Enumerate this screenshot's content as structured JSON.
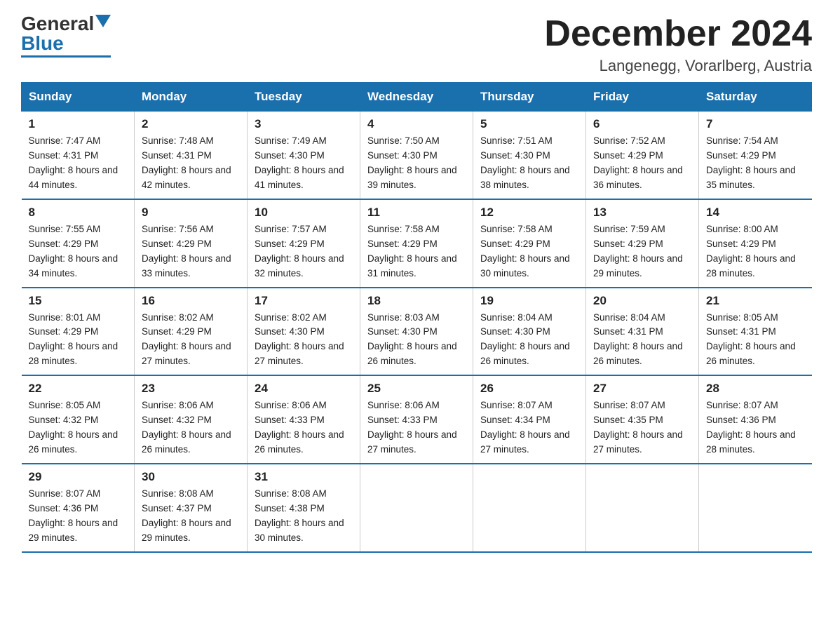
{
  "header": {
    "logo_general": "General",
    "logo_blue": "Blue",
    "month_title": "December 2024",
    "location": "Langenegg, Vorarlberg, Austria"
  },
  "days_of_week": [
    "Sunday",
    "Monday",
    "Tuesday",
    "Wednesday",
    "Thursday",
    "Friday",
    "Saturday"
  ],
  "weeks": [
    [
      {
        "num": "1",
        "sunrise": "7:47 AM",
        "sunset": "4:31 PM",
        "daylight": "8 hours and 44 minutes."
      },
      {
        "num": "2",
        "sunrise": "7:48 AM",
        "sunset": "4:31 PM",
        "daylight": "8 hours and 42 minutes."
      },
      {
        "num": "3",
        "sunrise": "7:49 AM",
        "sunset": "4:30 PM",
        "daylight": "8 hours and 41 minutes."
      },
      {
        "num": "4",
        "sunrise": "7:50 AM",
        "sunset": "4:30 PM",
        "daylight": "8 hours and 39 minutes."
      },
      {
        "num": "5",
        "sunrise": "7:51 AM",
        "sunset": "4:30 PM",
        "daylight": "8 hours and 38 minutes."
      },
      {
        "num": "6",
        "sunrise": "7:52 AM",
        "sunset": "4:29 PM",
        "daylight": "8 hours and 36 minutes."
      },
      {
        "num": "7",
        "sunrise": "7:54 AM",
        "sunset": "4:29 PM",
        "daylight": "8 hours and 35 minutes."
      }
    ],
    [
      {
        "num": "8",
        "sunrise": "7:55 AM",
        "sunset": "4:29 PM",
        "daylight": "8 hours and 34 minutes."
      },
      {
        "num": "9",
        "sunrise": "7:56 AM",
        "sunset": "4:29 PM",
        "daylight": "8 hours and 33 minutes."
      },
      {
        "num": "10",
        "sunrise": "7:57 AM",
        "sunset": "4:29 PM",
        "daylight": "8 hours and 32 minutes."
      },
      {
        "num": "11",
        "sunrise": "7:58 AM",
        "sunset": "4:29 PM",
        "daylight": "8 hours and 31 minutes."
      },
      {
        "num": "12",
        "sunrise": "7:58 AM",
        "sunset": "4:29 PM",
        "daylight": "8 hours and 30 minutes."
      },
      {
        "num": "13",
        "sunrise": "7:59 AM",
        "sunset": "4:29 PM",
        "daylight": "8 hours and 29 minutes."
      },
      {
        "num": "14",
        "sunrise": "8:00 AM",
        "sunset": "4:29 PM",
        "daylight": "8 hours and 28 minutes."
      }
    ],
    [
      {
        "num": "15",
        "sunrise": "8:01 AM",
        "sunset": "4:29 PM",
        "daylight": "8 hours and 28 minutes."
      },
      {
        "num": "16",
        "sunrise": "8:02 AM",
        "sunset": "4:29 PM",
        "daylight": "8 hours and 27 minutes."
      },
      {
        "num": "17",
        "sunrise": "8:02 AM",
        "sunset": "4:30 PM",
        "daylight": "8 hours and 27 minutes."
      },
      {
        "num": "18",
        "sunrise": "8:03 AM",
        "sunset": "4:30 PM",
        "daylight": "8 hours and 26 minutes."
      },
      {
        "num": "19",
        "sunrise": "8:04 AM",
        "sunset": "4:30 PM",
        "daylight": "8 hours and 26 minutes."
      },
      {
        "num": "20",
        "sunrise": "8:04 AM",
        "sunset": "4:31 PM",
        "daylight": "8 hours and 26 minutes."
      },
      {
        "num": "21",
        "sunrise": "8:05 AM",
        "sunset": "4:31 PM",
        "daylight": "8 hours and 26 minutes."
      }
    ],
    [
      {
        "num": "22",
        "sunrise": "8:05 AM",
        "sunset": "4:32 PM",
        "daylight": "8 hours and 26 minutes."
      },
      {
        "num": "23",
        "sunrise": "8:06 AM",
        "sunset": "4:32 PM",
        "daylight": "8 hours and 26 minutes."
      },
      {
        "num": "24",
        "sunrise": "8:06 AM",
        "sunset": "4:33 PM",
        "daylight": "8 hours and 26 minutes."
      },
      {
        "num": "25",
        "sunrise": "8:06 AM",
        "sunset": "4:33 PM",
        "daylight": "8 hours and 27 minutes."
      },
      {
        "num": "26",
        "sunrise": "8:07 AM",
        "sunset": "4:34 PM",
        "daylight": "8 hours and 27 minutes."
      },
      {
        "num": "27",
        "sunrise": "8:07 AM",
        "sunset": "4:35 PM",
        "daylight": "8 hours and 27 minutes."
      },
      {
        "num": "28",
        "sunrise": "8:07 AM",
        "sunset": "4:36 PM",
        "daylight": "8 hours and 28 minutes."
      }
    ],
    [
      {
        "num": "29",
        "sunrise": "8:07 AM",
        "sunset": "4:36 PM",
        "daylight": "8 hours and 29 minutes."
      },
      {
        "num": "30",
        "sunrise": "8:08 AM",
        "sunset": "4:37 PM",
        "daylight": "8 hours and 29 minutes."
      },
      {
        "num": "31",
        "sunrise": "8:08 AM",
        "sunset": "4:38 PM",
        "daylight": "8 hours and 30 minutes."
      },
      null,
      null,
      null,
      null
    ]
  ]
}
